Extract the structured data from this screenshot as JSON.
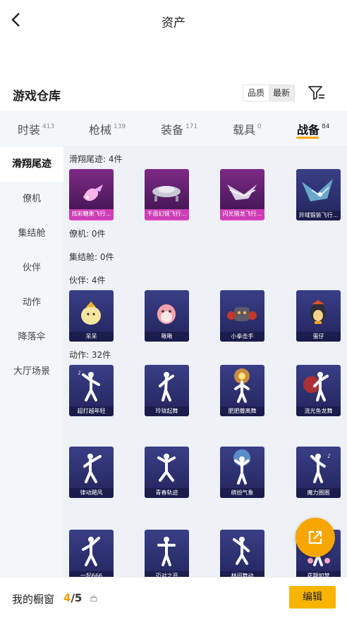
{
  "header": {
    "title": "资产",
    "back_icon": "chevron-left-icon"
  },
  "warehouse": {
    "title": "游戏仓库",
    "sort_options": [
      "品质",
      "最新"
    ],
    "filter_icon": "filter-icon"
  },
  "tabs": [
    {
      "label": "时装",
      "count": "413"
    },
    {
      "label": "枪械",
      "count": "139"
    },
    {
      "label": "装备",
      "count": "171"
    },
    {
      "label": "载具",
      "count": "0"
    },
    {
      "label": "战备",
      "count": "84",
      "active": true
    }
  ],
  "sidebar": [
    {
      "label": "滑翔尾迹",
      "active": true
    },
    {
      "label": "僚机"
    },
    {
      "label": "集结舱"
    },
    {
      "label": "伙伴"
    },
    {
      "label": "动作"
    },
    {
      "label": "降落伞"
    },
    {
      "label": "大厅场景"
    }
  ],
  "sections": {
    "trail": {
      "label": "滑翔尾迹: 4件",
      "items": [
        "炫彩糖果飞行...",
        "千面幻镜飞行...",
        "闪光猎龙飞行...",
        "异域锻装飞行..."
      ]
    },
    "wingman": {
      "label": "僚机: 0件"
    },
    "pod": {
      "label": "集结舱: 0件"
    },
    "companion": {
      "label": "伙伴: 4件",
      "items": [
        "呆呆",
        "啾啾",
        "小拳击手",
        "蛋仔"
      ]
    },
    "emote": {
      "label": "动作: 32件",
      "items": [
        "超打越年轻",
        "玲珑起舞",
        "肥肥撒离舞",
        "流光鱼龙舞",
        "律动飓风",
        "青春轨迹",
        "缤纷气象",
        "魔力圈圈",
        "一起666",
        "迈对之开",
        "林间舞动",
        "花期如梦"
      ]
    }
  },
  "showcase": {
    "label": "我的橱窗",
    "current": "4",
    "total": "/5",
    "edit_label": "编辑"
  },
  "colors": {
    "accent": "#f7a600",
    "trail_item_bg": "#7f2a86",
    "item_bg": "#2c3070"
  }
}
